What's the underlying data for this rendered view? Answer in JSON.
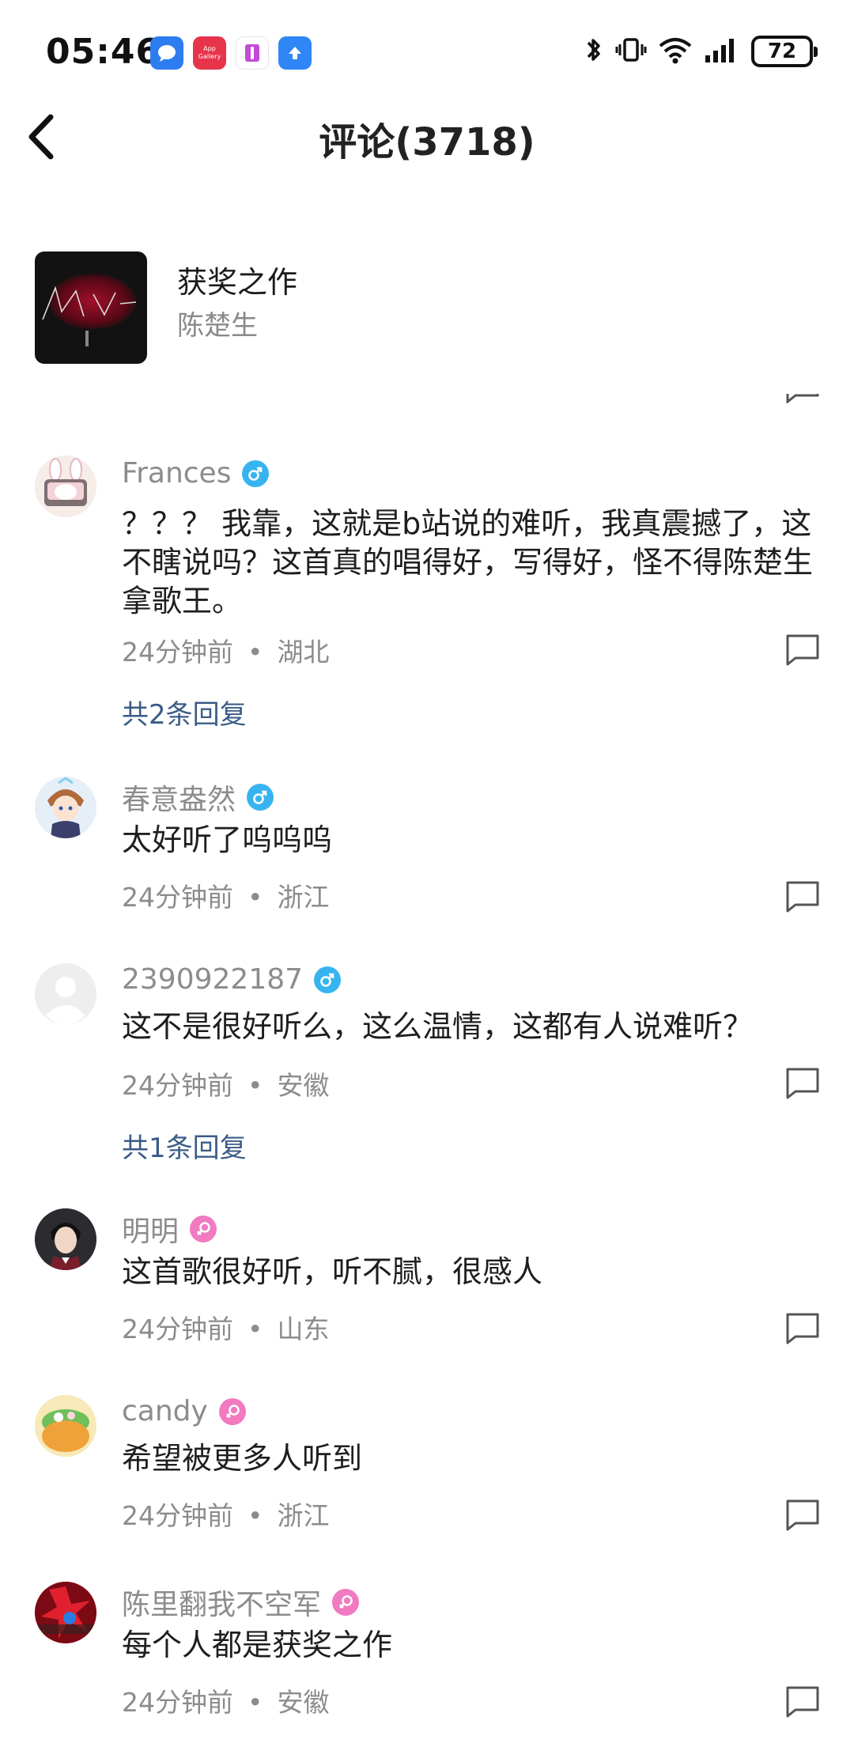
{
  "status_bar": {
    "time": "05:46",
    "notification_icons": [
      "message-icon",
      "app-gallery-icon",
      "app-icon",
      "upload-icon"
    ],
    "gallery_label": "App Gallery",
    "battery": "72"
  },
  "header": {
    "title": "评论(3718)"
  },
  "song": {
    "title": "获奖之作",
    "artist": "陈楚生"
  },
  "comments": [
    {
      "name": "Frances",
      "gender": "male",
      "text": "？？？ 我靠，这就是b站说的难听，我真震撼了，这不瞎说吗？这首真的唱得好，写得好，怪不得陈楚生拿歌王。",
      "time": "24分钟前",
      "location": "湖北",
      "replies": "共2条回复"
    },
    {
      "name": "春意盎然",
      "gender": "male",
      "text": "太好听了呜呜呜",
      "time": "24分钟前",
      "location": "浙江"
    },
    {
      "name": "2390922187",
      "gender": "male",
      "text": "这不是很好听么，这么温情，这都有人说难听？",
      "time": "24分钟前",
      "location": "安徽",
      "replies": "共1条回复"
    },
    {
      "name": "明明",
      "gender": "female",
      "text": "这首歌很好听，听不腻，很感人",
      "time": "24分钟前",
      "location": "山东"
    },
    {
      "name": "candy",
      "gender": "female",
      "text": "希望被更多人听到",
      "time": "24分钟前",
      "location": "浙江"
    },
    {
      "name": "陈里翻我不空军",
      "gender": "female",
      "text": "每个人都是获奖之作",
      "time": "24分钟前",
      "location": "安徽"
    }
  ],
  "separator": "•",
  "colors": {
    "male": "#37b4ef",
    "female": "#f17ac1",
    "reply_link": "#3b5c86",
    "meta": "#8c8c8c"
  }
}
